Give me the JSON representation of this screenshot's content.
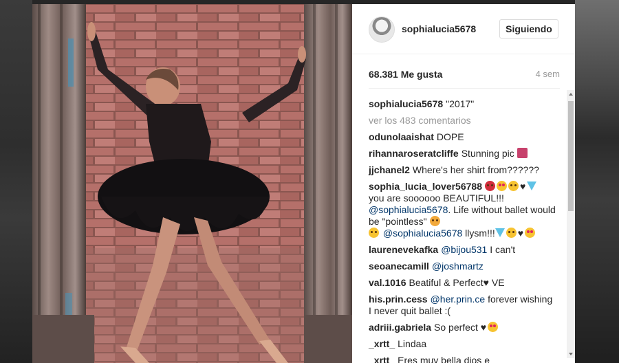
{
  "post": {
    "username": "sophialucia5678",
    "follow_label": "Siguiendo",
    "likes": "68.381 Me gusta",
    "time": "4 sem",
    "caption": "\"2017\"",
    "view_all_comments": "ver los 483 comentarios"
  },
  "comments": [
    {
      "user": "odunolaaishat",
      "text": "DOPE"
    },
    {
      "user": "rihannaroseratcliffe",
      "text": "Stunning pic"
    },
    {
      "user": "jjchanel2",
      "text": "Where's her shirt from??????"
    },
    {
      "user": "sophia_lucia_lover56788",
      "text1": "you are soooooo BEAUTIFUL!!!",
      "mention1": "@sophialucia5678",
      "text2": ". Life without ballet would be \"pointless\"",
      "mention2": "@sophialucia5678",
      "text3": " llysm!!!"
    },
    {
      "user": "laurenevekafka",
      "mention": "@bijou531",
      "text": " I can't"
    },
    {
      "user": "seoanecamill",
      "mention": "@joshmartz"
    },
    {
      "user": "val.1016",
      "text": "Beatiful & Perfect♥ VE"
    },
    {
      "user": "his.prin.cess",
      "mention": "@her.prin.ce",
      "text": " forever wishing I never quit ballet :("
    },
    {
      "user": "adriii.gabriela",
      "text": "So perfect"
    },
    {
      "user": "_xrtt_",
      "text": "Lindaa"
    },
    {
      "user": "_xrtt_",
      "text": "Eres muy bella dios e"
    }
  ],
  "icons": {
    "emoji_heart": "♥"
  },
  "colors": {
    "mention": "#003569",
    "muted": "#999999",
    "text": "#262626"
  }
}
